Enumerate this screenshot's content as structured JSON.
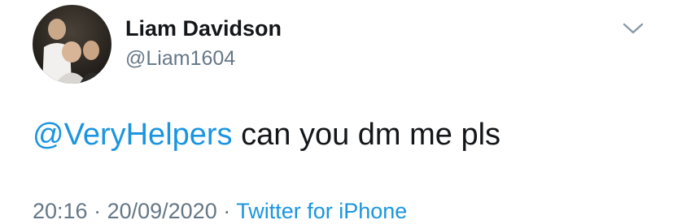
{
  "tweet": {
    "author": {
      "display_name": "Liam Davidson",
      "handle": "@Liam1604"
    },
    "menu_icon": "chevron-down-icon",
    "body": {
      "mention": "@VeryHelpers",
      "text": " can you dm me pls"
    },
    "meta": {
      "time": "20:16",
      "separator1": " · ",
      "date": "20/09/2020",
      "separator2": " · ",
      "source": "Twitter for iPhone"
    }
  },
  "colors": {
    "link": "#1b95e0",
    "secondary_text": "#657786",
    "primary_text": "#14171a"
  }
}
